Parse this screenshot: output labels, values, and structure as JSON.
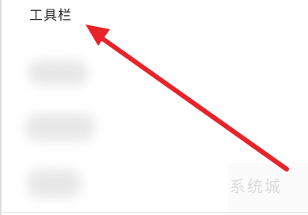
{
  "toolbar": {
    "title": "工具栏"
  },
  "watermark": {
    "text": "系统城"
  },
  "colors": {
    "arrow": "#e8232a",
    "background": "#ffffff",
    "placeholder": "#e8e8e8"
  },
  "menu": {
    "items": [
      {
        "state": "blurred"
      },
      {
        "state": "blurred"
      },
      {
        "state": "blurred"
      }
    ]
  }
}
